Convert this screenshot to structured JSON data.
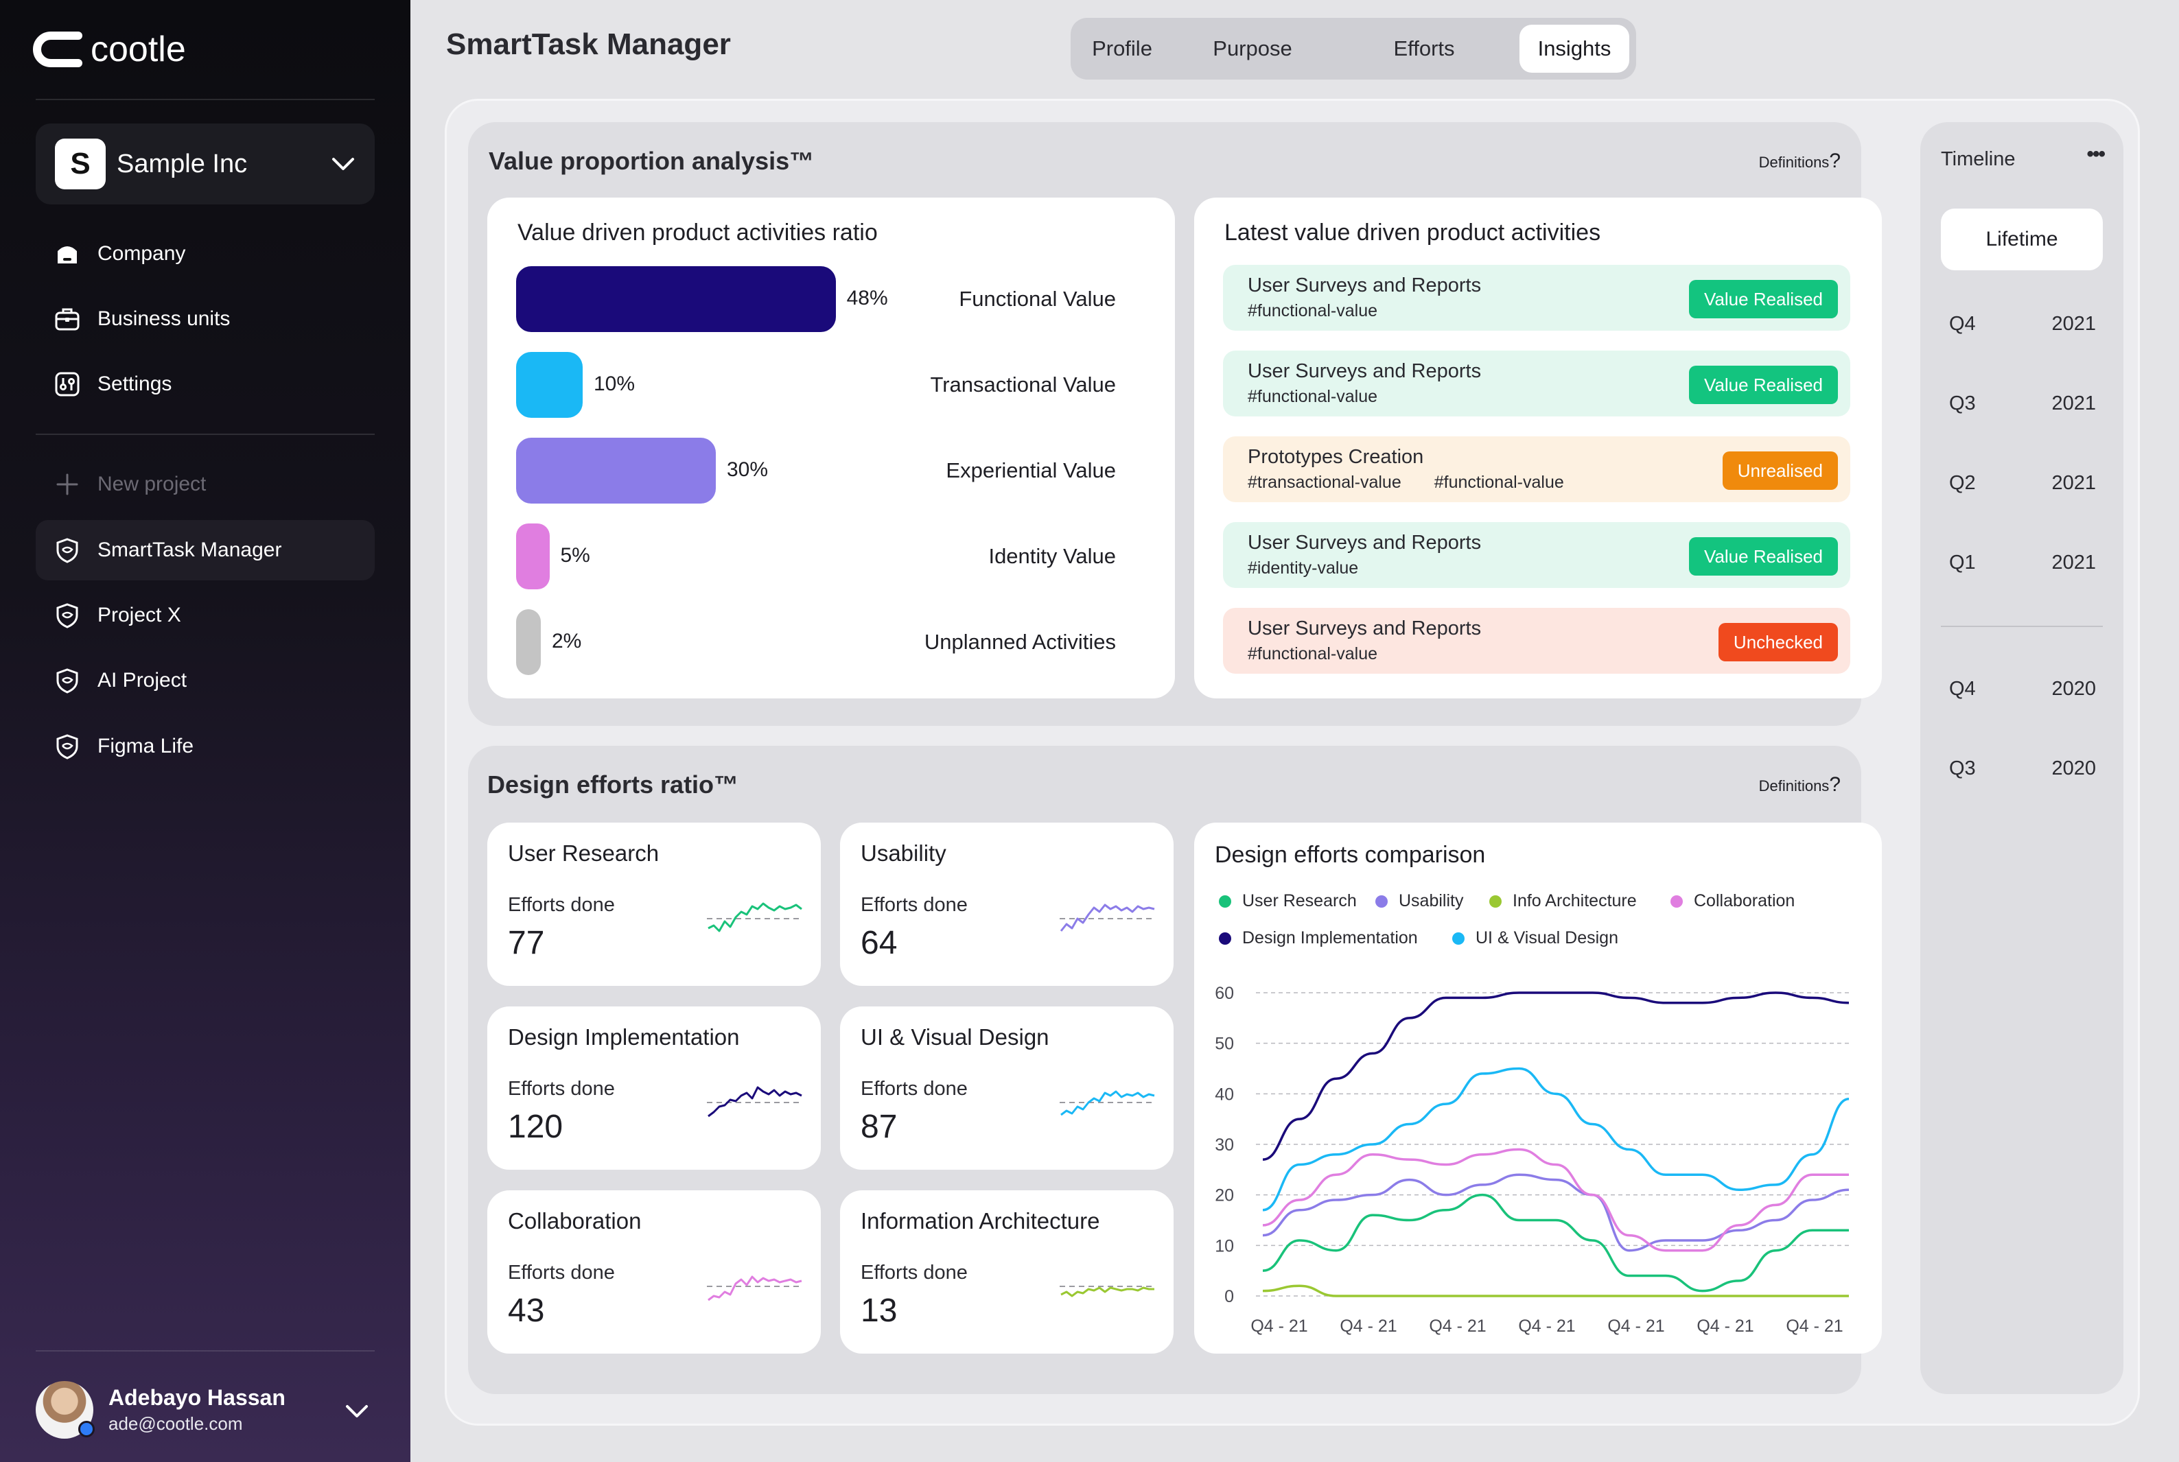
{
  "brand": {
    "name": "cootle"
  },
  "company": {
    "badge": "S",
    "name": "Sample Inc"
  },
  "nav": [
    {
      "label": "Company",
      "icon": "company-icon"
    },
    {
      "label": "Business units",
      "icon": "briefcase-icon"
    },
    {
      "label": "Settings",
      "icon": "sliders-icon"
    }
  ],
  "new_project": {
    "label": "New project"
  },
  "projects": [
    {
      "label": "SmartTask Manager",
      "active": true
    },
    {
      "label": "Project X"
    },
    {
      "label": "AI Project"
    },
    {
      "label": "Figma Life"
    }
  ],
  "user": {
    "name": "Adebayo Hassan",
    "email": "ade@cootle.com"
  },
  "header": {
    "title": "SmartTask Manager"
  },
  "tabs": [
    {
      "label": "Profile"
    },
    {
      "label": "Purpose"
    },
    {
      "label": "Efforts"
    },
    {
      "label": "Insights",
      "active": true
    }
  ],
  "value_section": {
    "title": "Value proportion analysis™",
    "definitions": "Definitions",
    "ratio_card": {
      "title": "Value driven product activities ratio",
      "rows": [
        {
          "label": "Functional Value",
          "pct": "48%",
          "value": 48,
          "color": "#1a0a7a"
        },
        {
          "label": "Transactional Value",
          "pct": "10%",
          "value": 10,
          "color": "#1ab8f5"
        },
        {
          "label": "Experiential Value",
          "pct": "30%",
          "value": 30,
          "color": "#8b7ce8"
        },
        {
          "label": "Identity Value",
          "pct": "5%",
          "value": 5,
          "color": "#e07ee0"
        },
        {
          "label": "Unplanned Activities",
          "pct": "2%",
          "value": 2,
          "color": "#c4c4c4"
        }
      ]
    },
    "latest_card": {
      "title": "Latest value driven product activities",
      "items": [
        {
          "title": "User Surveys and Reports",
          "tags": [
            "#functional-value"
          ],
          "status": "Value Realised",
          "status_color": "#13c47f",
          "bg": "#e3f7ef"
        },
        {
          "title": "User Surveys and Reports",
          "tags": [
            "#functional-value"
          ],
          "status": "Value Realised",
          "status_color": "#13c47f",
          "bg": "#e3f7ef"
        },
        {
          "title": "Prototypes Creation",
          "tags": [
            "#transactional-value",
            "#functional-value"
          ],
          "status": "Unrealised",
          "status_color": "#f08a0c",
          "bg": "#fdf1e1"
        },
        {
          "title": "User Surveys and Reports",
          "tags": [
            "#identity-value"
          ],
          "status": "Value Realised",
          "status_color": "#13c47f",
          "bg": "#e3f7ef"
        },
        {
          "title": "User Surveys and Reports",
          "tags": [
            "#functional-value"
          ],
          "status": "Unchecked",
          "status_color": "#f04a1e",
          "bg": "#fde6e0"
        }
      ]
    }
  },
  "effort_section": {
    "title": "Design efforts ratio™",
    "definitions": "Definitions",
    "efforts_label": "Efforts done",
    "cards": [
      {
        "title": "User Research",
        "value": "77",
        "color": "#19c27a"
      },
      {
        "title": "Usability",
        "value": "64",
        "color": "#8b7ce8"
      },
      {
        "title": "Design Implementation",
        "value": "120",
        "color": "#1a0a7a"
      },
      {
        "title": "UI & Visual Design",
        "value": "87",
        "color": "#1ab8f5"
      },
      {
        "title": "Collaboration",
        "value": "43",
        "color": "#e07ee0"
      },
      {
        "title": "Information Architecture",
        "value": "13",
        "color": "#9ac832"
      }
    ]
  },
  "chart_data": {
    "type": "line",
    "title": "Design efforts comparison",
    "x": [
      "Q4 - 21",
      "Q4 - 21",
      "Q4 - 21",
      "Q4 - 21",
      "Q4 - 21",
      "Q4 - 21",
      "Q4 - 21"
    ],
    "ylim": [
      0,
      60
    ],
    "yticks": [
      0,
      10,
      20,
      30,
      40,
      50,
      60
    ],
    "grid": true,
    "legend_position": "top",
    "series": [
      {
        "name": "User Research",
        "color": "#19c27a",
        "values": [
          5,
          11,
          9,
          16,
          15,
          17,
          20,
          15,
          15,
          11,
          4,
          4,
          1,
          3,
          9,
          13,
          13
        ]
      },
      {
        "name": "Usability",
        "color": "#8b7ce8",
        "values": [
          12,
          17,
          19,
          20,
          23,
          20,
          22,
          24,
          23,
          20,
          9,
          11,
          11,
          13,
          15,
          19,
          21
        ]
      },
      {
        "name": "Info Architecture",
        "color": "#9ac832",
        "values": [
          1,
          2,
          0,
          0,
          0,
          0,
          0,
          0,
          0,
          0,
          0,
          0,
          0,
          0,
          0,
          0,
          0
        ]
      },
      {
        "name": "Collaboration",
        "color": "#e07ee0",
        "values": [
          14,
          19,
          24,
          28,
          27,
          26,
          28,
          29,
          26,
          20,
          12,
          9,
          9,
          14,
          18,
          24,
          24
        ]
      },
      {
        "name": "Design Implementation",
        "color": "#1a0a7a",
        "values": [
          27,
          35,
          43,
          48,
          55,
          59,
          59,
          60,
          60,
          60,
          59,
          58,
          58,
          59,
          60,
          59,
          58
        ]
      },
      {
        "name": "UI & Visual Design",
        "color": "#1ab8f5",
        "values": [
          17,
          26,
          28,
          30,
          34,
          38,
          44,
          45,
          40,
          34,
          29,
          24,
          24,
          21,
          22,
          28,
          39
        ]
      }
    ]
  },
  "timeline": {
    "title": "Timeline",
    "filter": "Lifetime",
    "rows_2021": [
      {
        "q": "Q4",
        "y": "2021"
      },
      {
        "q": "Q3",
        "y": "2021"
      },
      {
        "q": "Q2",
        "y": "2021"
      },
      {
        "q": "Q1",
        "y": "2021"
      }
    ],
    "rows_2020": [
      {
        "q": "Q4",
        "y": "2020"
      },
      {
        "q": "Q3",
        "y": "2020"
      }
    ]
  }
}
